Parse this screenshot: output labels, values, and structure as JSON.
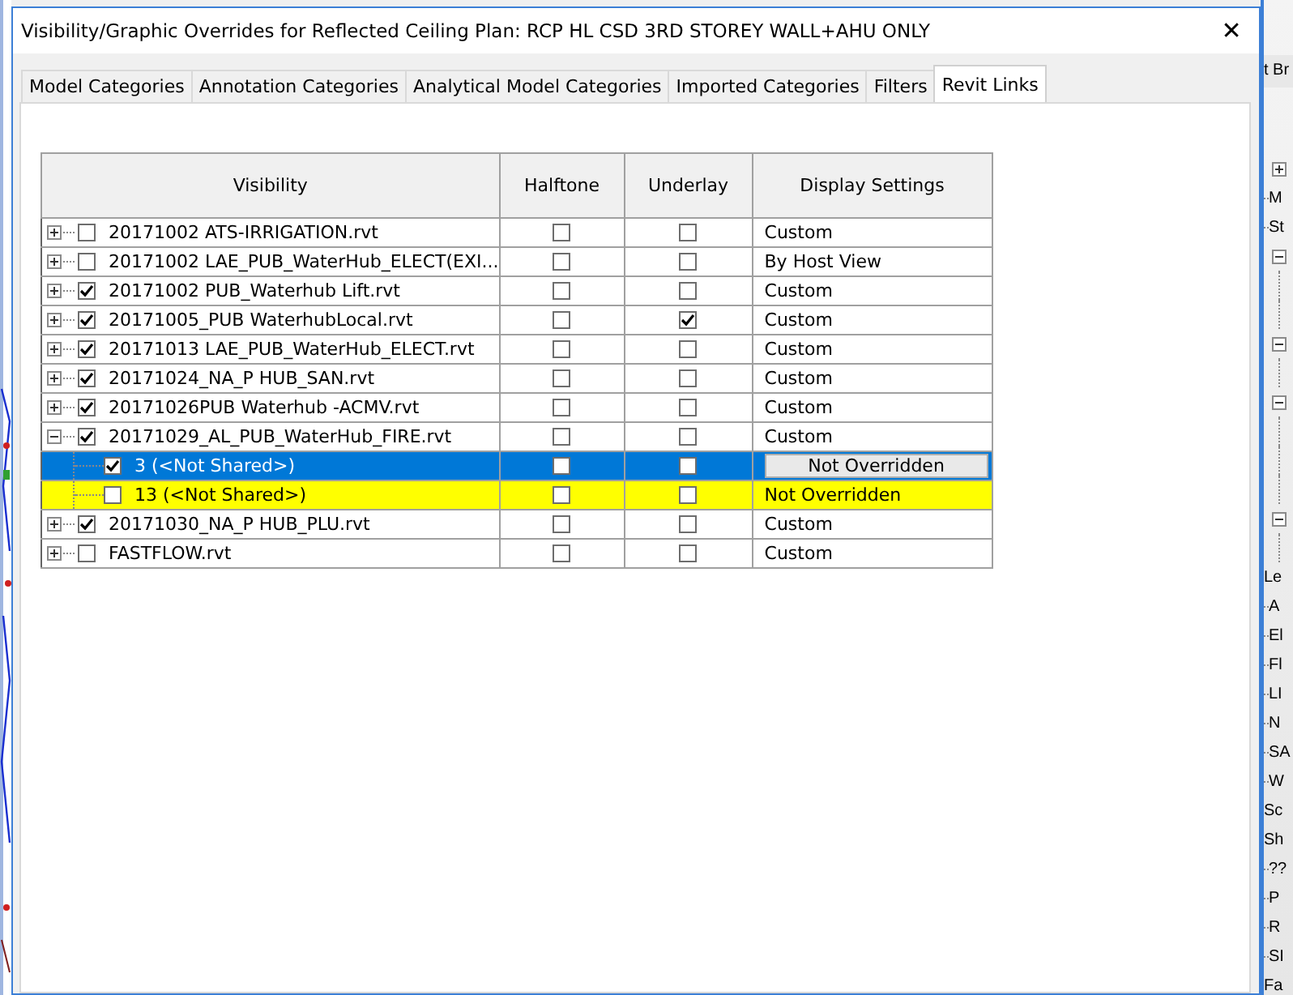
{
  "window": {
    "title": "Visibility/Graphic Overrides for Reflected Ceiling Plan: RCP HL CSD 3RD STOREY WALL+AHU ONLY",
    "close": "✕"
  },
  "tabs": [
    {
      "label": "Model Categories",
      "selected": false
    },
    {
      "label": "Annotation Categories",
      "selected": false
    },
    {
      "label": "Analytical Model Categories",
      "selected": false
    },
    {
      "label": "Imported Categories",
      "selected": false
    },
    {
      "label": "Filters",
      "selected": false
    },
    {
      "label": "Revit Links",
      "selected": true
    }
  ],
  "table": {
    "columns": [
      "Visibility",
      "Halftone",
      "Underlay",
      "Display Settings"
    ],
    "rows": [
      {
        "name": "20171002 ATS-IRRIGATION.rvt",
        "checked": false,
        "halftone": false,
        "underlay": false,
        "display": "Custom",
        "expanded": false
      },
      {
        "name": "20171002 LAE_PUB_WaterHub_ELECT(EXI...",
        "checked": false,
        "halftone": false,
        "underlay": false,
        "display": "By Host View",
        "expanded": false
      },
      {
        "name": "20171002 PUB_Waterhub Lift.rvt",
        "checked": true,
        "halftone": false,
        "underlay": false,
        "display": "Custom",
        "expanded": false
      },
      {
        "name": "20171005_PUB WaterhubLocal.rvt",
        "checked": true,
        "halftone": false,
        "underlay": true,
        "display": "Custom",
        "expanded": false
      },
      {
        "name": "20171013 LAE_PUB_WaterHub_ELECT.rvt",
        "checked": true,
        "halftone": false,
        "underlay": false,
        "display": "Custom",
        "expanded": false
      },
      {
        "name": "20171024_NA_P HUB_SAN.rvt",
        "checked": true,
        "halftone": false,
        "underlay": false,
        "display": "Custom",
        "expanded": false
      },
      {
        "name": "20171026PUB Waterhub -ACMV.rvt",
        "checked": true,
        "halftone": false,
        "underlay": false,
        "display": "Custom",
        "expanded": false
      },
      {
        "name": "20171029_AL_PUB_WaterHub_FIRE.rvt",
        "checked": true,
        "halftone": false,
        "underlay": false,
        "display": "Custom",
        "expanded": true,
        "children": [
          {
            "name": "3 (<Not Shared>)",
            "checked": true,
            "halftone": false,
            "underlay": false,
            "display": "Not Overridden",
            "selected": true,
            "highlighted": false
          },
          {
            "name": "13 (<Not Shared>)",
            "checked": false,
            "halftone": false,
            "underlay": false,
            "display": "Not Overridden",
            "selected": false,
            "highlighted": true
          }
        ]
      },
      {
        "name": "20171030_NA_P HUB_PLU.rvt",
        "checked": true,
        "halftone": false,
        "underlay": false,
        "display": "Custom",
        "expanded": false
      },
      {
        "name": "FASTFLOW.rvt",
        "checked": false,
        "halftone": false,
        "underlay": false,
        "display": "Custom",
        "expanded": false
      }
    ]
  },
  "project_browser": {
    "title": "t Br",
    "items": [
      {
        "kind": "plus"
      },
      {
        "kind": "text",
        "label": "M"
      },
      {
        "kind": "text",
        "label": "St"
      },
      {
        "kind": "minus"
      },
      {
        "kind": "line"
      },
      {
        "kind": "line"
      },
      {
        "kind": "minus"
      },
      {
        "kind": "line"
      },
      {
        "kind": "minus"
      },
      {
        "kind": "line"
      },
      {
        "kind": "line"
      },
      {
        "kind": "line"
      },
      {
        "kind": "minus"
      },
      {
        "kind": "line"
      },
      {
        "kind": "heading",
        "label": "Le"
      },
      {
        "kind": "text",
        "label": "A"
      },
      {
        "kind": "text",
        "label": "El"
      },
      {
        "kind": "text",
        "label": "Fl"
      },
      {
        "kind": "text",
        "label": "LI"
      },
      {
        "kind": "text",
        "label": "N"
      },
      {
        "kind": "text",
        "label": "SA"
      },
      {
        "kind": "text",
        "label": "W"
      },
      {
        "kind": "heading",
        "label": "Sc"
      },
      {
        "kind": "heading",
        "label": "Sh"
      },
      {
        "kind": "text",
        "label": "??"
      },
      {
        "kind": "text",
        "label": "P"
      },
      {
        "kind": "text",
        "label": "R"
      },
      {
        "kind": "text",
        "label": "SI"
      },
      {
        "kind": "heading",
        "label": "Fa"
      }
    ]
  }
}
